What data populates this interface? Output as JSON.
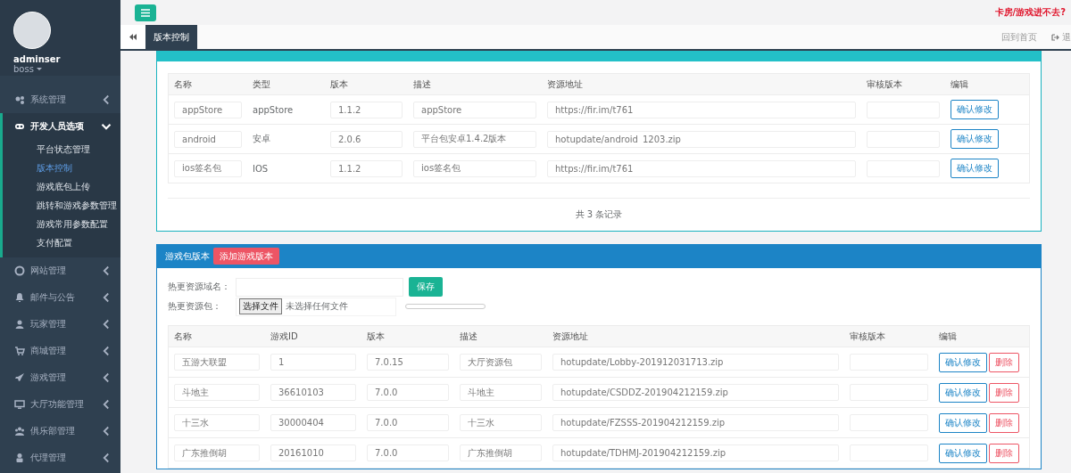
{
  "sidebar": {
    "profile": {
      "name": "adminser",
      "role": "boss"
    },
    "items": [
      {
        "label": "系统管理",
        "expanded": false
      },
      {
        "label": "开发人员选项",
        "expanded": true,
        "children": [
          {
            "label": "平台状态管理",
            "selected": false
          },
          {
            "label": "版本控制",
            "selected": true
          },
          {
            "label": "游戏底包上传",
            "selected": false
          },
          {
            "label": "跳转和游戏参数管理",
            "selected": false
          },
          {
            "label": "游戏常用参数配置",
            "selected": false
          },
          {
            "label": "支付配置",
            "selected": false
          }
        ]
      },
      {
        "label": "网站管理",
        "expanded": false
      },
      {
        "label": "邮件与公告",
        "expanded": false
      },
      {
        "label": "玩家管理",
        "expanded": false
      },
      {
        "label": "商城管理",
        "expanded": false
      },
      {
        "label": "游戏管理",
        "expanded": false
      },
      {
        "label": "大厅功能管理",
        "expanded": false
      },
      {
        "label": "俱乐部管理",
        "expanded": false
      },
      {
        "label": "代理管理",
        "expanded": false
      }
    ]
  },
  "top_bar": {
    "notice": "卡房/游戏进不去?"
  },
  "tab_bar": {
    "tabs": [
      {
        "label": "版本控制",
        "selected": true
      }
    ],
    "home_link": "回到首页",
    "logout_link": "退"
  },
  "platform_panel": {
    "columns": [
      "名称",
      "类型",
      "版本",
      "描述",
      "资源地址",
      "审核版本",
      "编辑"
    ],
    "rows": [
      {
        "name": "appStore",
        "type": "appStore",
        "version": "1.1.2",
        "description": "appStore",
        "url": "https://fir.im/t761",
        "button": "确认修改"
      },
      {
        "name": "android",
        "type": "安卓",
        "version": "2.0.6",
        "description": "平台包安卓1.4.2版本",
        "url": "hotupdate/android_1203.zip",
        "button": "确认修改"
      },
      {
        "name": "ios签名包",
        "type": "IOS",
        "version": "1.1.2",
        "description": "ios签名包",
        "url": "https://fir.im/t761",
        "button": "确认修改"
      }
    ],
    "footer": "共 3 条记录"
  },
  "game_panel": {
    "title": "游戏包版本",
    "add_button": "添加游戏版本",
    "domain_label": "热更资源域名：",
    "save_button": "保存",
    "package_label": "热更资源包：",
    "file_button": "选择文件",
    "file_status": "未选择任何文件",
    "upload": {
      "level": 0
    },
    "columns": [
      "名称",
      "游戏ID",
      "版本",
      "描述",
      "资源地址",
      "审核版本",
      "编辑"
    ],
    "rows": [
      {
        "name": "五游大联盟",
        "game_id": "1",
        "version": "7.0.15",
        "description": "大厅资源包",
        "url": "hotupdate/Lobby-201912031713.zip",
        "confirm": "确认修改",
        "delete": "删除"
      },
      {
        "name": "斗地主",
        "game_id": "36610103",
        "version": "7.0.0",
        "description": "斗地主",
        "url": "hotupdate/CSDDZ-201904212159.zip",
        "confirm": "确认修改",
        "delete": "删除"
      },
      {
        "name": "十三水",
        "game_id": "30000404",
        "version": "7.0.0",
        "description": "十三水",
        "url": "hotupdate/FZSSS-201904212159.zip",
        "confirm": "确认修改",
        "delete": "删除"
      },
      {
        "name": "广东推倒胡",
        "game_id": "20161010",
        "version": "7.0.0",
        "description": "广东推倒胡",
        "url": "hotupdate/TDHMJ-201904212159.zip",
        "confirm": "确认修改",
        "delete": "删除"
      }
    ]
  }
}
